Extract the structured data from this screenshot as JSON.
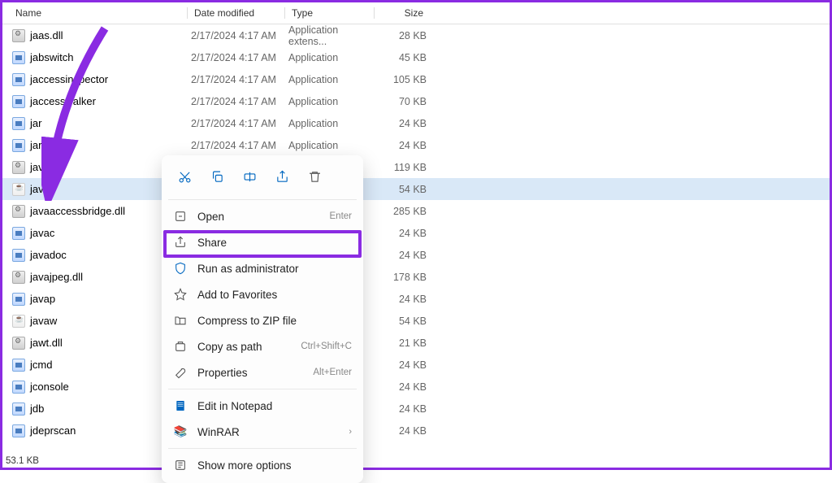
{
  "columns": {
    "name": "Name",
    "date": "Date modified",
    "type": "Type",
    "size": "Size"
  },
  "files": [
    {
      "name": "jaas.dll",
      "date": "2/17/2024 4:17 AM",
      "type": "Application extens...",
      "size": "28 KB",
      "icon": "dll"
    },
    {
      "name": "jabswitch",
      "date": "2/17/2024 4:17 AM",
      "type": "Application",
      "size": "45 KB",
      "icon": "app"
    },
    {
      "name": "jaccessinspector",
      "date": "2/17/2024 4:17 AM",
      "type": "Application",
      "size": "105 KB",
      "icon": "app"
    },
    {
      "name": "jaccesswalker",
      "date": "2/17/2024 4:17 AM",
      "type": "Application",
      "size": "70 KB",
      "icon": "app"
    },
    {
      "name": "jar",
      "date": "2/17/2024 4:17 AM",
      "type": "Application",
      "size": "24 KB",
      "icon": "app"
    },
    {
      "name": "jarsigner",
      "date": "2/17/2024 4:17 AM",
      "type": "Application",
      "size": "24 KB",
      "icon": "app"
    },
    {
      "name": "java.dL",
      "date": "",
      "type": "",
      "size": "119 KB",
      "icon": "dll"
    },
    {
      "name": "java",
      "date": "",
      "type": "",
      "size": "54 KB",
      "icon": "java",
      "selected": true
    },
    {
      "name": "javaaccessbridge.dll",
      "date": "",
      "type": "",
      "size": "285 KB",
      "icon": "dll"
    },
    {
      "name": "javac",
      "date": "",
      "type": "",
      "size": "24 KB",
      "icon": "app"
    },
    {
      "name": "javadoc",
      "date": "",
      "type": "",
      "size": "24 KB",
      "icon": "app"
    },
    {
      "name": "javajpeg.dll",
      "date": "",
      "type": "",
      "size": "178 KB",
      "icon": "dll"
    },
    {
      "name": "javap",
      "date": "",
      "type": "",
      "size": "24 KB",
      "icon": "app"
    },
    {
      "name": "javaw",
      "date": "",
      "type": "",
      "size": "54 KB",
      "icon": "java"
    },
    {
      "name": "jawt.dll",
      "date": "",
      "type": "",
      "size": "21 KB",
      "icon": "dll"
    },
    {
      "name": "jcmd",
      "date": "",
      "type": "",
      "size": "24 KB",
      "icon": "app"
    },
    {
      "name": "jconsole",
      "date": "",
      "type": "",
      "size": "24 KB",
      "icon": "app"
    },
    {
      "name": "jdb",
      "date": "",
      "type": "",
      "size": "24 KB",
      "icon": "app"
    },
    {
      "name": "jdeprscan",
      "date": "2/17/2024 4:17 AM",
      "type": "Application",
      "size": "24 KB",
      "icon": "app"
    }
  ],
  "context_menu": {
    "open": "Open",
    "open_sc": "Enter",
    "share": "Share",
    "run_admin": "Run as administrator",
    "favorites": "Add to Favorites",
    "compress": "Compress to ZIP file",
    "copy_path": "Copy as path",
    "copy_path_sc": "Ctrl+Shift+C",
    "properties": "Properties",
    "properties_sc": "Alt+Enter",
    "notepad": "Edit in Notepad",
    "winrar": "WinRAR",
    "more": "Show more options"
  },
  "status": "53.1 KB"
}
